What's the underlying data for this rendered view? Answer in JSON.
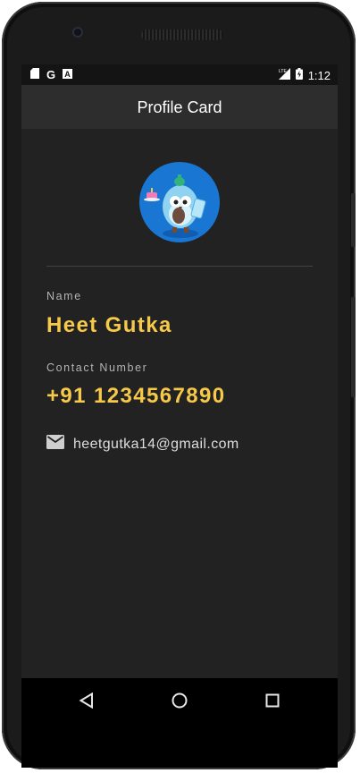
{
  "status_bar": {
    "time": "1:12",
    "icons": [
      "sd-card-icon",
      "google-icon",
      "font-icon",
      "lte-signal-icon",
      "battery-charging-icon"
    ]
  },
  "app_bar": {
    "title": "Profile Card"
  },
  "profile": {
    "avatar_icon": "bird-mascot-avatar",
    "name_label": "Name",
    "name_value": "Heet Gutka",
    "contact_label": "Contact Number",
    "contact_value": "+91 1234567890",
    "email": "heetgutka14@gmail.com"
  },
  "nav_bar": {
    "buttons": [
      "back-icon",
      "home-icon",
      "recents-icon"
    ]
  },
  "colors": {
    "accent": "#f7c948",
    "avatar_bg": "#1976d2",
    "surface": "#222222",
    "app_bar": "#2d2d2d",
    "label": "#b3b3b3"
  }
}
